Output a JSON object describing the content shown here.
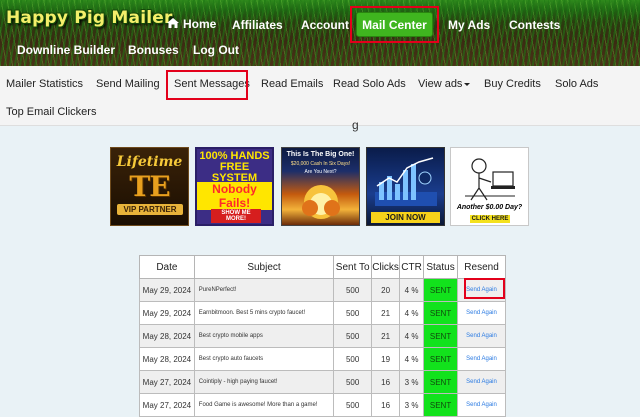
{
  "site": {
    "logo": "Happy Pig Mailer"
  },
  "nav": [
    {
      "label": "Home",
      "icon": "home-icon"
    },
    {
      "label": "Affiliates"
    },
    {
      "label": "Account"
    },
    {
      "label": "Mail Center",
      "active": true
    },
    {
      "label": "My Ads"
    },
    {
      "label": "Contests"
    },
    {
      "label": "Downline Builder"
    },
    {
      "label": "Bonuses"
    },
    {
      "label": "Log Out"
    }
  ],
  "subnav": [
    {
      "label": "Mailer Statistics"
    },
    {
      "label": "Send Mailing"
    },
    {
      "label": "Sent Messages",
      "highlighted": true
    },
    {
      "label": "Read Emails"
    },
    {
      "label": "Read Solo Ads"
    },
    {
      "label": "View ads",
      "dropdown": true
    },
    {
      "label": "Buy Credits"
    },
    {
      "label": "Solo Ads"
    },
    {
      "label": "Top Email Clickers"
    }
  ],
  "page_heading_fragment": "g",
  "banners": [
    {
      "line1": "Lifetime",
      "line2": "TE",
      "line3": "VIP PARTNER"
    },
    {
      "line1": "100% HANDS FREE SYSTEM",
      "line2": "Nobody Fails!",
      "line3": "SHOW ME MORE!"
    },
    {
      "line1": "This Is The Big One!",
      "line2": "$20,000 Cash In Six Days!",
      "line3": "Are You Next?"
    },
    {
      "line1": "JOIN NOW"
    },
    {
      "line1": "Another $0.00 Day?",
      "line2": "CLICK HERE"
    }
  ],
  "table": {
    "headers": [
      "Date",
      "Subject",
      "Sent To",
      "Clicks",
      "CTR",
      "Status",
      "Resend"
    ],
    "rows": [
      {
        "date": "May 29, 2024",
        "subject": "PureNPerfect!",
        "sent_to": "500",
        "clicks": "20",
        "ctr": "4 %",
        "status": "SENT",
        "resend": "Send Again"
      },
      {
        "date": "May 29, 2024",
        "subject": "Earnbitmoon. Best 5 mins crypto faucet!",
        "sent_to": "500",
        "clicks": "21",
        "ctr": "4 %",
        "status": "SENT",
        "resend": "Send Again"
      },
      {
        "date": "May 28, 2024",
        "subject": "Best crypto mobile apps",
        "sent_to": "500",
        "clicks": "21",
        "ctr": "4 %",
        "status": "SENT",
        "resend": "Send Again"
      },
      {
        "date": "May 28, 2024",
        "subject": "Best crypto auto faucets",
        "sent_to": "500",
        "clicks": "19",
        "ctr": "4 %",
        "status": "SENT",
        "resend": "Send Again"
      },
      {
        "date": "May 27, 2024",
        "subject": "Cointiply - high paying faucet!",
        "sent_to": "500",
        "clicks": "16",
        "ctr": "3 %",
        "status": "SENT",
        "resend": "Send Again"
      },
      {
        "date": "May 27, 2024",
        "subject": "Food Game is awesome! More than a game!",
        "sent_to": "500",
        "clicks": "16",
        "ctr": "3 %",
        "status": "SENT",
        "resend": "Send Again"
      }
    ]
  },
  "colors": {
    "accent_green": "#3fb51f",
    "status_green": "#12e21c",
    "highlight_red": "#e3001b",
    "link_blue": "#2a7ae2"
  }
}
